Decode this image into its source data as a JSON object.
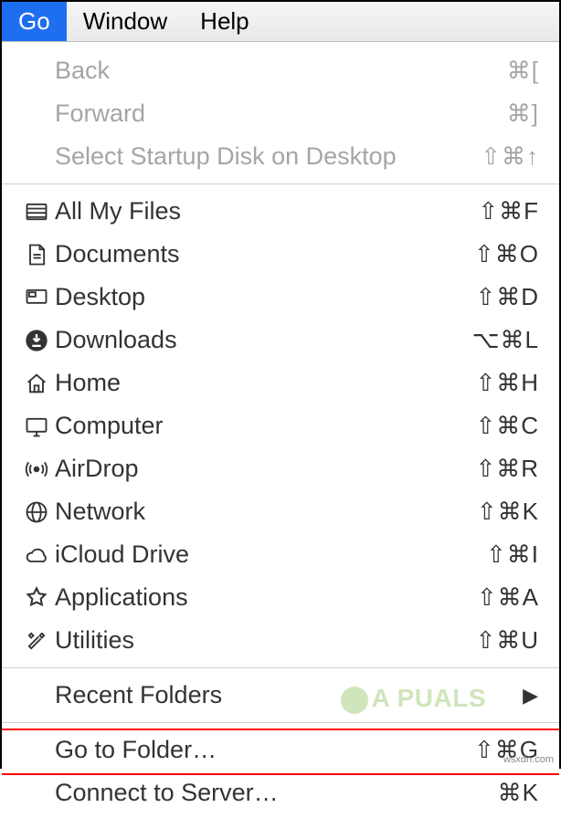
{
  "menubar": {
    "go": "Go",
    "window": "Window",
    "help": "Help"
  },
  "section1": [
    {
      "label": "Back",
      "shortcut": "⌘["
    },
    {
      "label": "Forward",
      "shortcut": "⌘]"
    },
    {
      "label": "Select Startup Disk on Desktop",
      "shortcut": "⇧⌘↑"
    }
  ],
  "section2": [
    {
      "label": "All My Files",
      "shortcut": "⇧⌘F",
      "icon": "all-files"
    },
    {
      "label": "Documents",
      "shortcut": "⇧⌘O",
      "icon": "documents"
    },
    {
      "label": "Desktop",
      "shortcut": "⇧⌘D",
      "icon": "desktop"
    },
    {
      "label": "Downloads",
      "shortcut": "⌥⌘L",
      "icon": "downloads"
    },
    {
      "label": "Home",
      "shortcut": "⇧⌘H",
      "icon": "home"
    },
    {
      "label": "Computer",
      "shortcut": "⇧⌘C",
      "icon": "computer"
    },
    {
      "label": "AirDrop",
      "shortcut": "⇧⌘R",
      "icon": "airdrop"
    },
    {
      "label": "Network",
      "shortcut": "⇧⌘K",
      "icon": "network"
    },
    {
      "label": "iCloud Drive",
      "shortcut": "⇧⌘I",
      "icon": "icloud"
    },
    {
      "label": "Applications",
      "shortcut": "⇧⌘A",
      "icon": "applications"
    },
    {
      "label": "Utilities",
      "shortcut": "⇧⌘U",
      "icon": "utilities"
    }
  ],
  "section3": {
    "recent": "Recent Folders",
    "goto": "Go to Folder…",
    "goto_shortcut": "⇧⌘G",
    "connect": "Connect to Server…",
    "connect_shortcut": "⌘K"
  },
  "watermark": "A PUALS",
  "source": "wsxdn.com"
}
